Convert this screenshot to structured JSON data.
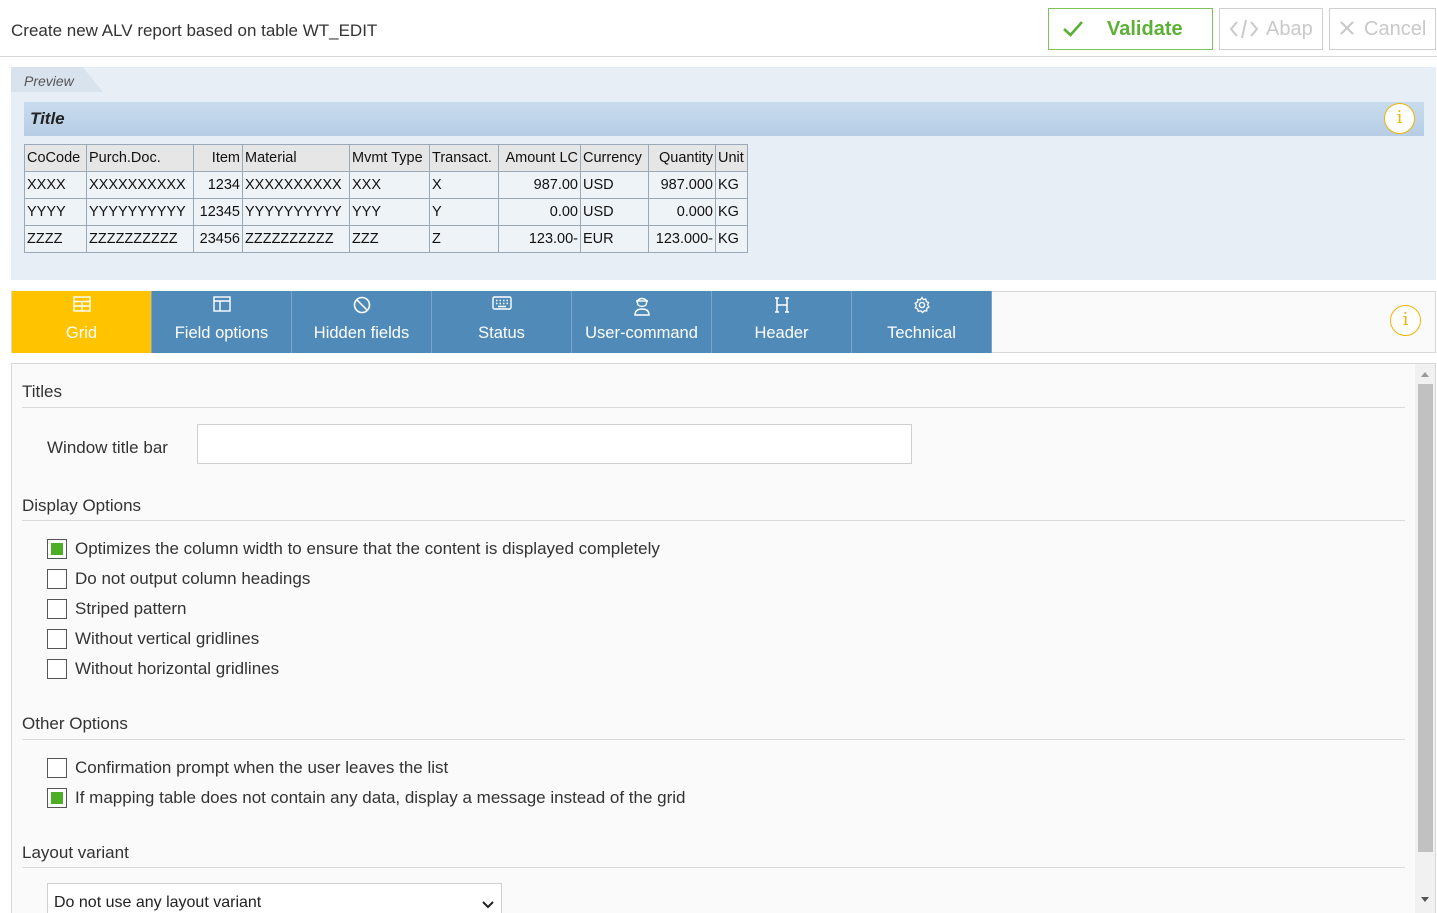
{
  "header": {
    "title": "Create new ALV report based on table WT_EDIT",
    "validate_label": "Validate",
    "abap_label": "Abap",
    "cancel_label": "Cancel"
  },
  "preview": {
    "label": "Preview",
    "title": "Title",
    "columns": [
      "CoCode",
      "Purch.Doc.",
      "Item",
      "Material",
      "Mvmt Type",
      "Transact.",
      "Amount LC",
      "Currency",
      "Quantity",
      "Unit"
    ],
    "rows": [
      [
        "XXXX",
        "XXXXXXXXXX",
        "1234",
        "XXXXXXXXXX",
        "XXX",
        "X",
        "987.00",
        "USD",
        "987.000",
        "KG"
      ],
      [
        "YYYY",
        "YYYYYYYYYY",
        "12345",
        "YYYYYYYYYY",
        "YYY",
        "Y",
        "0.00",
        "USD",
        "0.000",
        "KG"
      ],
      [
        "ZZZZ",
        "ZZZZZZZZZZ",
        "23456",
        "ZZZZZZZZZZ",
        "ZZZ",
        "Z",
        "123.00-",
        "EUR",
        "123.000-",
        "KG"
      ]
    ]
  },
  "tabs": [
    {
      "label": "Grid",
      "icon": "grid-icon",
      "active": true
    },
    {
      "label": "Field options",
      "icon": "layout-icon",
      "active": false
    },
    {
      "label": "Hidden fields",
      "icon": "prohibited-icon",
      "active": false
    },
    {
      "label": "Status",
      "icon": "keyboard-icon",
      "active": false
    },
    {
      "label": "User-command",
      "icon": "user-icon",
      "active": false
    },
    {
      "label": "Header",
      "icon": "header-h-icon",
      "active": false
    },
    {
      "label": "Technical",
      "icon": "gear-icon",
      "active": false
    }
  ],
  "form": {
    "titles_section": "Titles",
    "window_title_label": "Window title bar",
    "window_title_value": "",
    "display_section": "Display Options",
    "display_options": [
      {
        "label": "Optimizes the column width to ensure that the content is displayed completely",
        "checked": true
      },
      {
        "label": "Do not output column headings",
        "checked": false
      },
      {
        "label": "Striped pattern",
        "checked": false
      },
      {
        "label": "Without vertical gridlines",
        "checked": false
      },
      {
        "label": "Without horizontal gridlines",
        "checked": false
      }
    ],
    "other_section": "Other Options",
    "other_options": [
      {
        "label": "Confirmation prompt when the user leaves the list",
        "checked": false
      },
      {
        "label": "If mapping table does not contain any data, display a message instead of the grid",
        "checked": true
      }
    ],
    "layout_section": "Layout variant",
    "layout_variant_value": "Do not use any layout variant"
  },
  "colors": {
    "validate_green": "#5cb135",
    "tab_blue": "#4f8ab8",
    "tab_active": "#ffc300",
    "info_yellow": "#f0b400",
    "checkbox_green": "#4cae24"
  }
}
